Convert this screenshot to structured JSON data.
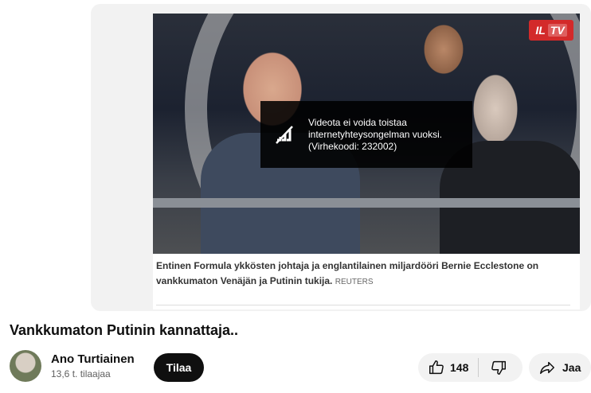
{
  "player": {
    "logo_il": "IL",
    "logo_tv": "TV",
    "error_lines": [
      "Videota ei voida toistaa",
      "internetyhteysongelman vuoksi.",
      "(Virhekoodi: 232002)"
    ],
    "caption": "Entinen Formula ykkösten johtaja ja englantilainen miljardööri Bernie Ecclestone on vankkumaton Venäjän ja Putinin tukija.",
    "caption_source": "REUTERS"
  },
  "video": {
    "title": "Vankkumaton Putinin kannattaja.."
  },
  "channel": {
    "name": "Ano Turtiainen",
    "subscribers": "13,6 t. tilaajaa",
    "subscribe_label": "Tilaa"
  },
  "actions": {
    "like_count": "148",
    "share_label": "Jaa"
  }
}
